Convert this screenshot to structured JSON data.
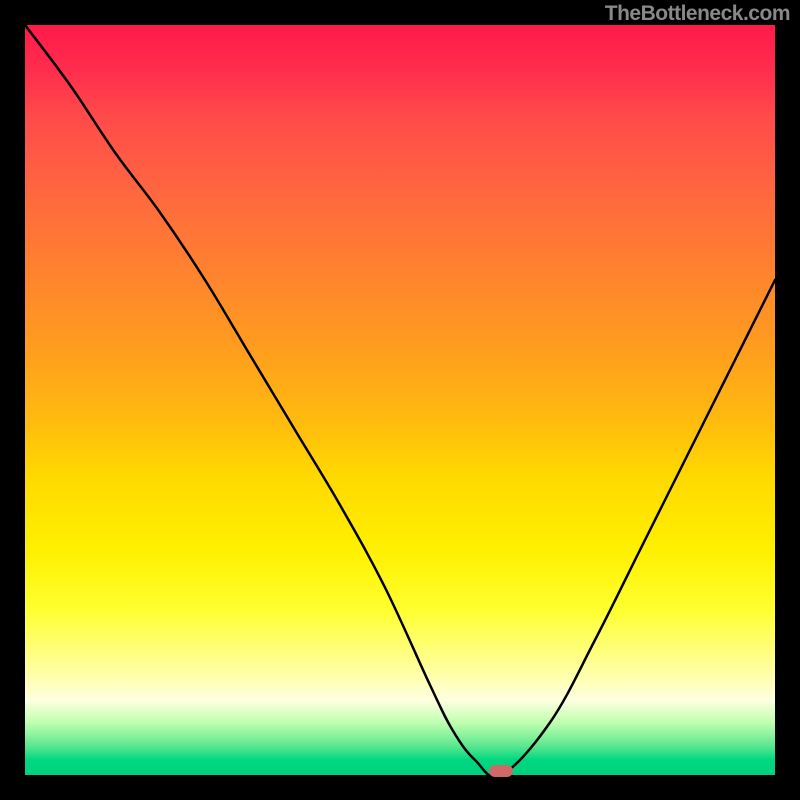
{
  "watermark": "TheBottleneck.com",
  "colors": {
    "gradient_top": "#ff1a4a",
    "gradient_mid": "#ffe000",
    "gradient_bottom": "#00d080",
    "curve": "#000000",
    "marker": "#d16868",
    "frame": "#000000"
  },
  "chart_data": {
    "type": "line",
    "title": "",
    "xlabel": "",
    "ylabel": "",
    "xlim": [
      0,
      100
    ],
    "ylim": [
      0,
      100
    ],
    "grid": false,
    "annotations": [
      "TheBottleneck.com"
    ],
    "series": [
      {
        "name": "bottleneck-curve",
        "x": [
          0,
          6,
          12,
          18,
          24,
          30,
          36,
          42,
          48,
          54,
          57,
          60,
          63.5,
          70,
          76,
          82,
          88,
          94,
          100
        ],
        "values": [
          100,
          92,
          83,
          75,
          66,
          56,
          46,
          36,
          25,
          12,
          6,
          2,
          0,
          7,
          18,
          30,
          42,
          54,
          66
        ]
      }
    ],
    "marker": {
      "x": 63.5,
      "y": 0
    }
  }
}
